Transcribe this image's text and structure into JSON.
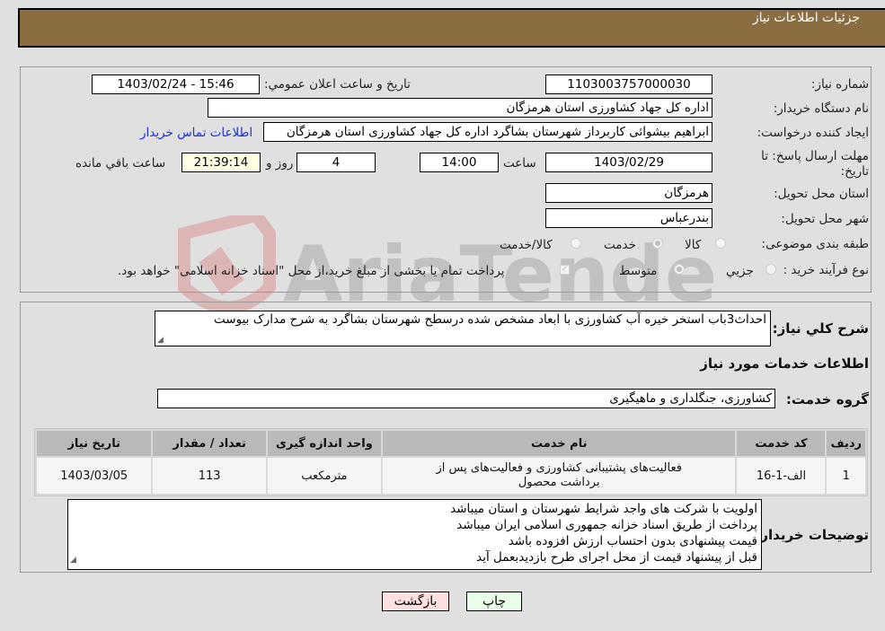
{
  "header": {
    "title": "جزئیات اطلاعات نیاز"
  },
  "form": {
    "need_number": {
      "label": "شماره نیاز:",
      "value": "1103003757000030"
    },
    "announce_datetime": {
      "label": "تاریخ و ساعت اعلان عمومي:",
      "value": "1403/02/24 - 15:46"
    },
    "buyer_org": {
      "label": "نام دستگاه خریدار:",
      "value": "اداره کل جهاد کشاورزی استان هرمزگان"
    },
    "requester": {
      "label": "ایجاد کننده درخواست:",
      "value": "ابراهیم بیشوائی کاربرداز شهرستان بشاگرد اداره کل جهاد کشاورزی استان هرمزگان"
    },
    "buyer_contact_link": "اطلاعات تماس خریدار",
    "deadline": {
      "label": "مهلت ارسال پاسخ: تا تاریخ:",
      "date": "1403/02/29",
      "time_label": "ساعت",
      "time": "14:00",
      "days": "4",
      "days_label": "روز و",
      "remaining": "21:39:14",
      "remaining_label": "ساعت باقي مانده"
    },
    "delivery_province": {
      "label": "استان محل تحویل:",
      "value": "هرمزگان"
    },
    "delivery_city": {
      "label": "شهر محل تحویل:",
      "value": "بندرعباس"
    },
    "category": {
      "label": "طبقه بندی موضوعی:",
      "options": [
        "کالا",
        "خدمت",
        "کالا/خدمت"
      ],
      "selected": "خدمت"
    },
    "purchase_type": {
      "label": "نوع فرآیند خرید :",
      "options": [
        "جزيي",
        "متوسط"
      ],
      "selected": "متوسط",
      "payment_note": "پرداخت تمام یا بخشی از مبلغ خرید،از محل \"اسناد خزانه اسلامی\" خواهد بود.",
      "payment_checked": true
    }
  },
  "description": {
    "label": "شرح کلي نیاز:",
    "value": "احداث3باب استخر خیره آب کشاورزی با ابعاد مشخص شده درسطح شهرستان بشاگرد به شرح مدارک بیوست"
  },
  "services_section_title": "اطلاعات خدمات مورد نیاز",
  "service_group": {
    "label": "گروه خدمت:",
    "value": "کشاورزی، جنگلداری و ماهیگیری"
  },
  "services_table": {
    "headers": [
      "ردیف",
      "کد خدمت",
      "نام خدمت",
      "واحد اندازه گیری",
      "تعداد / مقدار",
      "تاریخ نیاز"
    ],
    "rows": [
      [
        "1",
        "الف-1-16",
        "فعالیت‌های پشتیبانی کشاورزی و فعالیت‌های پس از برداشت محصول",
        "مترمکعب",
        "113",
        "1403/03/05"
      ]
    ]
  },
  "buyer_notes": {
    "label": "توضیحات خریدار:",
    "lines": [
      "اولویت با شرکت های واجد شرایط شهرستان و استان میباشد",
      "پرداخت از طریق اسناد خزانه جمهوری اسلامی ایران میباشد",
      "قیمت پیشنهادی بدون احتساب ارزش افزوده باشد",
      "قبل از پیشنهاد قیمت از محل اجرای طرح بازدیدبعمل آید"
    ]
  },
  "buttons": {
    "print": "چاپ",
    "back": "بازگشت"
  },
  "colors": {
    "header_bg": "#8b6d42",
    "print_bg": "#eaffea",
    "back_bg": "#ffe0e0",
    "link": "#1a2fd6"
  },
  "watermark": "AriaTender.neT"
}
